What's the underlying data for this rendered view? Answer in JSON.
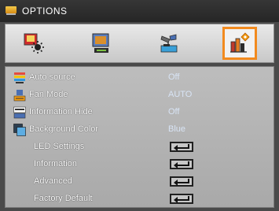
{
  "window": {
    "title": "OPTIONS"
  },
  "tabs": [
    {
      "name": "picture-tab",
      "icon": "picture-brightness-icon",
      "selected": false
    },
    {
      "name": "display-tab",
      "icon": "display-screen-icon",
      "selected": false
    },
    {
      "name": "setup-tab",
      "icon": "setup-projector-icon",
      "selected": false
    },
    {
      "name": "options-tab",
      "icon": "options-chart-icon",
      "selected": true
    }
  ],
  "menu": {
    "items": [
      {
        "label": "Auto source",
        "value": "Off",
        "icon": "auto-source-icon"
      },
      {
        "label": "Fan Mode",
        "value": "AUTO",
        "icon": "fan-mode-icon"
      },
      {
        "label": "Information Hide",
        "value": "Off",
        "icon": "information-hide-icon"
      },
      {
        "label": "Background Color",
        "value": "Blue",
        "icon": "background-color-icon"
      },
      {
        "label": "LED Settings",
        "value": "",
        "icon": "enter-icon"
      },
      {
        "label": "Information",
        "value": "",
        "icon": "enter-icon"
      },
      {
        "label": "Advanced",
        "value": "",
        "icon": "enter-icon"
      },
      {
        "label": "Factory Default",
        "value": "",
        "icon": "enter-icon"
      }
    ]
  },
  "colors": {
    "accent": "#f28a1e",
    "value_text": "#d8e4f5"
  }
}
